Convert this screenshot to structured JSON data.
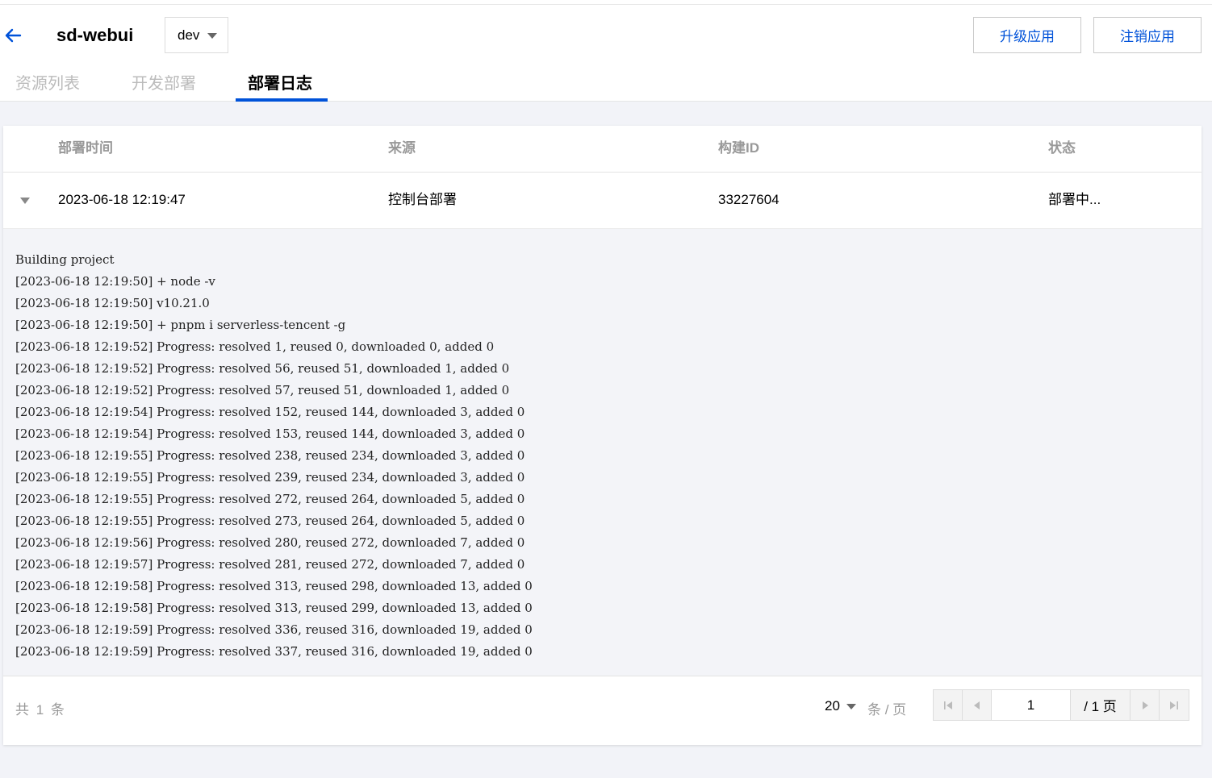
{
  "header": {
    "app_name": "sd-webui",
    "env_value": "dev",
    "buttons": {
      "upgrade": "升级应用",
      "unregister": "注销应用"
    },
    "tabs": [
      {
        "label": "资源列表",
        "active": false
      },
      {
        "label": "开发部署",
        "active": false
      },
      {
        "label": "部署日志",
        "active": true
      }
    ]
  },
  "table": {
    "columns": [
      "部署时间",
      "来源",
      "构建ID",
      "状态"
    ],
    "rows": [
      {
        "time": "2023-06-18 12:19:47",
        "source": "控制台部署",
        "build_id": "33227604",
        "status": "部署中..."
      }
    ]
  },
  "log_lines": [
    "Building project",
    "[2023-06-18 12:19:50] + node -v",
    "[2023-06-18 12:19:50] v10.21.0",
    "[2023-06-18 12:19:50] + pnpm i serverless-tencent -g",
    "[2023-06-18 12:19:52] Progress: resolved 1, reused 0, downloaded 0, added 0",
    "[2023-06-18 12:19:52] Progress: resolved 56, reused 51, downloaded 1, added 0",
    "[2023-06-18 12:19:52] Progress: resolved 57, reused 51, downloaded 1, added 0",
    "[2023-06-18 12:19:54] Progress: resolved 152, reused 144, downloaded 3, added 0",
    "[2023-06-18 12:19:54] Progress: resolved 153, reused 144, downloaded 3, added 0",
    "[2023-06-18 12:19:55] Progress: resolved 238, reused 234, downloaded 3, added 0",
    "[2023-06-18 12:19:55] Progress: resolved 239, reused 234, downloaded 3, added 0",
    "[2023-06-18 12:19:55] Progress: resolved 272, reused 264, downloaded 5, added 0",
    "[2023-06-18 12:19:55] Progress: resolved 273, reused 264, downloaded 5, added 0",
    "[2023-06-18 12:19:56] Progress: resolved 280, reused 272, downloaded 7, added 0",
    "[2023-06-18 12:19:57] Progress: resolved 281, reused 272, downloaded 7, added 0",
    "[2023-06-18 12:19:58] Progress: resolved 313, reused 298, downloaded 13, added 0",
    "[2023-06-18 12:19:58] Progress: resolved 313, reused 299, downloaded 13, added 0",
    "[2023-06-18 12:19:59] Progress: resolved 336, reused 316, downloaded 19, added 0",
    "[2023-06-18 12:19:59] Progress: resolved 337, reused 316, downloaded 19, added 0"
  ],
  "pagination": {
    "total_text": "共 1 条",
    "page_size": "20",
    "per_page_text": "条 / 页",
    "current_page": "1",
    "total_pages_text": "/ 1 页"
  },
  "colors": {
    "accent": "#0052d9",
    "muted": "#999999",
    "log_bg": "#f3f4f8"
  }
}
